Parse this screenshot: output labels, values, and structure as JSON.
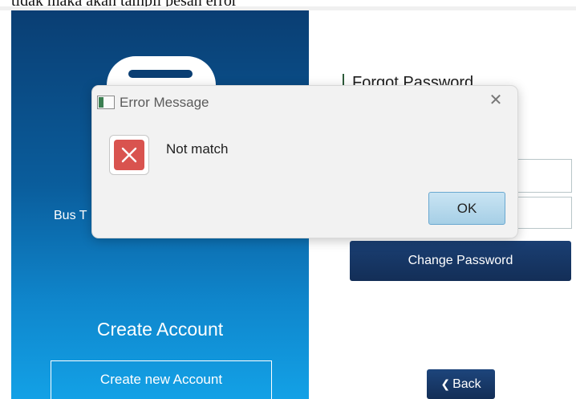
{
  "caption": {
    "text": "tidak maka akan tampil pesan error"
  },
  "left_panel": {
    "bus_title": "Bus T",
    "create_heading": "Create Account",
    "create_button": "Create new Account"
  },
  "right_panel": {
    "heading": "Forgot Password",
    "change_password_button": "Change Password",
    "back_button": "Back"
  },
  "dialog": {
    "title": "Error Message",
    "message": "Not match",
    "ok_button": "OK",
    "close_glyph": "✕",
    "icon": "error-x-icon"
  },
  "colors": {
    "left_panel_top": "#0a3e73",
    "left_panel_bottom": "#13a1e6",
    "primary_button": "#1a3f73",
    "error_red": "#d9534f",
    "ok_button": "#b5d9ee"
  }
}
